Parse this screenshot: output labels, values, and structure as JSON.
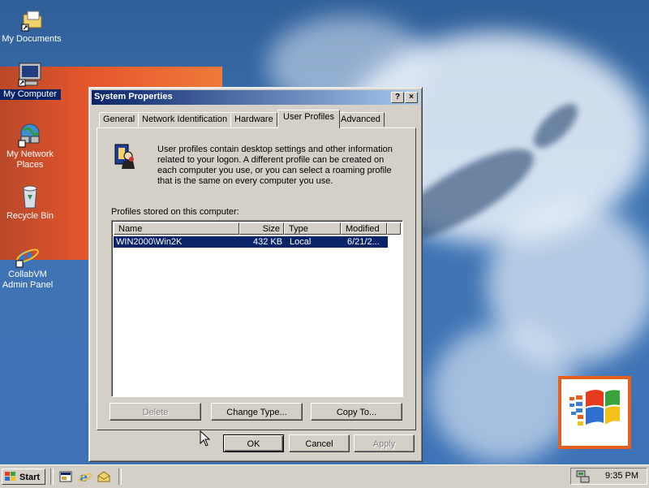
{
  "desktop": {
    "icons": [
      {
        "label": "My Documents",
        "icon": "my-documents-icon"
      },
      {
        "label": "My Computer",
        "icon": "my-computer-icon"
      },
      {
        "label": "My Network Places",
        "icon": "network-places-icon"
      },
      {
        "label": "Recycle Bin",
        "icon": "recycle-bin-icon"
      },
      {
        "label": "CollabVM Admin Panel",
        "icon": "internet-explorer-icon"
      }
    ]
  },
  "dialog": {
    "title": "System Properties",
    "help_button": "?",
    "close_button": "×",
    "tabs": [
      "General",
      "Network Identification",
      "Hardware",
      "User Profiles",
      "Advanced"
    ],
    "active_tab": "User Profiles",
    "info_text": "User profiles contain desktop settings and other information related to your logon.  A different profile can be created on each computer you use, or you can select a roaming profile that is the same on every computer you use.",
    "profiles_label": "Profiles stored on this computer:",
    "columns": [
      "Name",
      "Size",
      "Type",
      "Modified"
    ],
    "rows": [
      {
        "name": "WIN2000\\Win2K",
        "size": "432 KB",
        "type": "Local",
        "modified": "6/21/2..."
      }
    ],
    "buttons": {
      "delete": "Delete",
      "change_type": "Change Type...",
      "copy_to": "Copy To...",
      "ok": "OK",
      "cancel": "Cancel",
      "apply": "Apply"
    }
  },
  "taskbar": {
    "start_label": "Start",
    "clock": "9:35 PM"
  },
  "colors": {
    "titlebar": "#0a246a",
    "selection": "#0a246a",
    "face": "#d4d0c8",
    "desktop": "#3a6ea5"
  }
}
